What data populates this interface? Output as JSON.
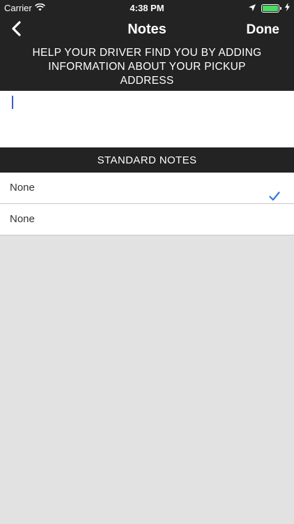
{
  "status_bar": {
    "carrier": "Carrier",
    "time": "4:38 PM",
    "icons": [
      "wifi-icon",
      "location-arrow-icon",
      "battery-icon",
      "charging-bolt-icon"
    ],
    "battery_color": "#4cd964"
  },
  "nav": {
    "title": "Notes",
    "done_label": "Done",
    "back_icon": "chevron-left-icon"
  },
  "banner": {
    "text": "HELP YOUR DRIVER FIND YOU BY ADDING INFORMATION ABOUT YOUR PICKUP ADDRESS"
  },
  "notes_input": {
    "value": "",
    "placeholder": ""
  },
  "standard_notes": {
    "header": "STANDARD NOTES",
    "items": [
      {
        "label": "None",
        "selected": true
      },
      {
        "label": "None",
        "selected": false
      }
    ]
  },
  "colors": {
    "bar_background": "#232323",
    "page_background": "#e2e2e2",
    "accent": "#2f7ad9",
    "cursor": "#3a5bd9"
  }
}
